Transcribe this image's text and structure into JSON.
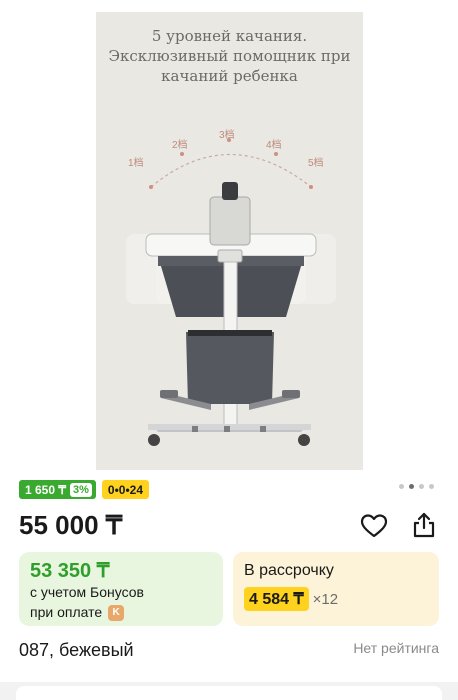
{
  "image": {
    "caption_lines": [
      "5 уровней качания.",
      "Эксклюзивный помощник при",
      "качаний ребенка"
    ],
    "levels": [
      "1档",
      "2档",
      "3档",
      "4档",
      "5档"
    ]
  },
  "badges": {
    "bonus_amount": "1 650 ₸",
    "bonus_percent": "3%",
    "installment": "0•0•24"
  },
  "carousel": {
    "count": 4,
    "active_index": 1
  },
  "price": "55 000 ₸",
  "bonus_card": {
    "amount": "53 350 ₸",
    "line1": "с учетом Бонусов",
    "line2": "при оплате"
  },
  "installment_card": {
    "title": "В рассрочку",
    "monthly": "4 584 ₸",
    "multiplier": "×12"
  },
  "variant": "087, бежевый",
  "rating": "Нет рейтинга",
  "colors": {
    "bonus_green": "#3aa92f",
    "installment_yellow": "#ffd21e",
    "bonus_card_bg": "#e9f6df",
    "installment_card_bg": "#fdf3d9"
  },
  "icons": {
    "favorite": "heart-icon",
    "share": "share-icon",
    "payment": "kaspi-icon"
  }
}
